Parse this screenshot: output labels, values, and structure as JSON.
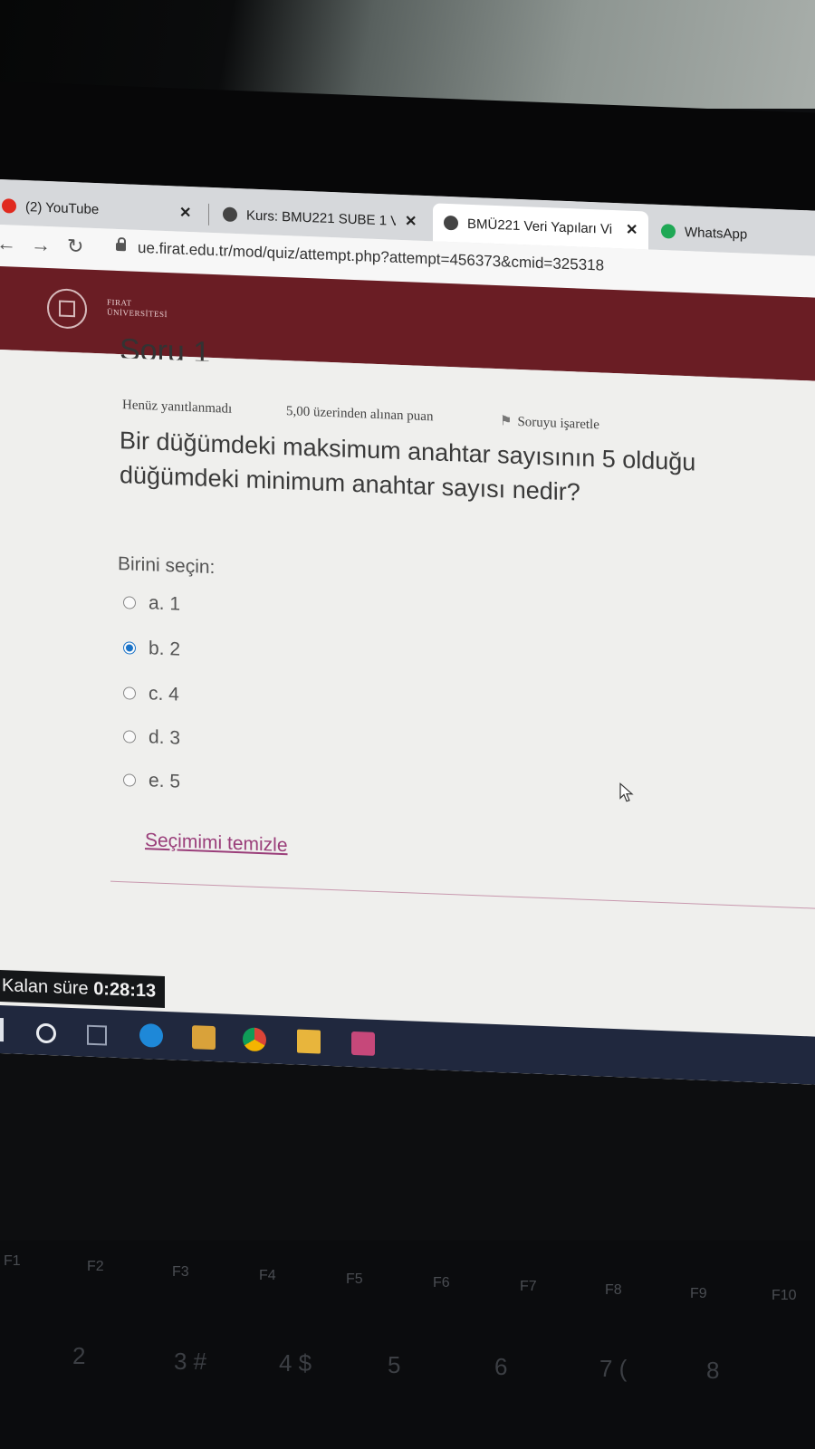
{
  "browser": {
    "tabs": [
      {
        "label": "(2) YouTube",
        "favicon_color": "#e02a1f",
        "active": false
      },
      {
        "label": "Kurs: BMU221 SUBE 1 V",
        "favicon_color": "#444444",
        "active": false
      },
      {
        "label": "BMÜ221 Veri Yapıları Vi",
        "favicon_color": "#444444",
        "active": true
      },
      {
        "label": "WhatsApp",
        "favicon_color": "#1fa855",
        "active": false
      }
    ],
    "url": "ue.firat.edu.tr/mod/quiz/attempt.php?attempt=456373&cmid=325318"
  },
  "site": {
    "logo_text_line1": "FIRAT",
    "logo_text_line2": "ÜNİVERSİTESİ",
    "brand_color": "#6a1d24"
  },
  "quiz": {
    "question_title": "Soru 1",
    "status": "Henüz yanıtlanmadı",
    "grade": "5,00 üzerinden alınan puan",
    "flag_label": "Soruyu işaretle",
    "question_line1": "Bir düğümdeki maksimum anahtar sayısının 5 olduğu",
    "question_line2": "düğümdeki minimum anahtar sayısı nedir?",
    "prompt": "Birini seçin:",
    "options": [
      {
        "label": "a. 1",
        "selected": false
      },
      {
        "label": "b. 2",
        "selected": true
      },
      {
        "label": "c. 4",
        "selected": false
      },
      {
        "label": "d. 3",
        "selected": false
      },
      {
        "label": "e. 5",
        "selected": false
      }
    ],
    "clear_choice": "Seçimimi temizle",
    "timer_label": "Kalan süre",
    "timer_value": "0:28:13"
  },
  "taskbar": {
    "icons": [
      "start-icon",
      "search-circle-icon",
      "task-view-icon",
      "edge-icon",
      "store-icon",
      "chrome-icon",
      "file-explorer-icon",
      "app-icon"
    ]
  },
  "keyboard": {
    "function_keys": [
      "F1",
      "F2",
      "F3",
      "F4",
      "F5",
      "F6",
      "F7",
      "F8",
      "F9",
      "F10"
    ],
    "number_keys": [
      "2",
      "3 #",
      "4 $",
      "5",
      "6",
      "7 (",
      "8"
    ]
  }
}
